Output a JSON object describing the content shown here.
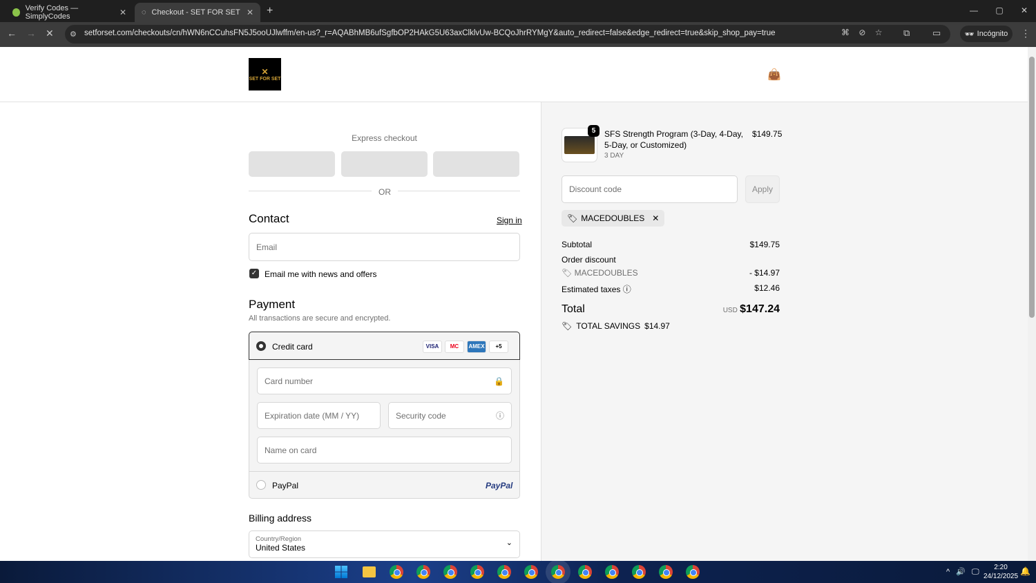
{
  "browser": {
    "tabs": [
      {
        "title": "Verify Codes — SimplyCodes"
      },
      {
        "title": "Checkout - SET FOR SET"
      }
    ],
    "url": "setforset.com/checkouts/cn/hWN6nCCuhsFN5J5ooUJlwffm/en-us?_r=AQABhMB6ufSgfbOP2HAkG5U63axClklvUw-BCQoJhrRYMgY&auto_redirect=false&edge_redirect=true&skip_shop_pay=true",
    "incognito_label": "Incógnito"
  },
  "store": {
    "logo_text": "SET FOR SET"
  },
  "checkout": {
    "express_label": "Express checkout",
    "or_label": "OR",
    "contact": {
      "heading": "Contact",
      "sign_in": "Sign in",
      "email_placeholder": "Email",
      "newsletter_label": "Email me with news and offers",
      "newsletter_checked": true
    },
    "payment": {
      "heading": "Payment",
      "subtext": "All transactions are secure and encrypted.",
      "credit_card_label": "Credit card",
      "cards": [
        "VISA",
        "MC",
        "AMEX",
        "+5"
      ],
      "card_number": "Card number",
      "expiry": "Expiration date (MM / YY)",
      "security": "Security code",
      "name_on_card": "Name on card",
      "paypal_label": "PayPal",
      "paypal_logo": "PayPal"
    },
    "billing": {
      "heading": "Billing address",
      "country_label": "Country/Region",
      "country_value": "United States"
    }
  },
  "summary": {
    "item": {
      "quantity": "5",
      "name": "SFS Strength Program (3-Day, 4-Day, 5-Day, or Customized)",
      "variant": "3 DAY",
      "price": "$149.75"
    },
    "discount_placeholder": "Discount code",
    "apply_label": "Apply",
    "applied_code": "MACEDOUBLES",
    "subtotal_label": "Subtotal",
    "subtotal": "$149.75",
    "order_discount_label": "Order discount",
    "discount_code": "MACEDOUBLES",
    "discount_amount": "- $14.97",
    "taxes_label": "Estimated taxes",
    "taxes": "$12.46",
    "total_label": "Total",
    "currency": "USD",
    "total": "$147.24",
    "savings_label": "TOTAL SAVINGS",
    "savings": "$14.97"
  },
  "taskbar": {
    "time": "2:20",
    "date": "24/12/2025"
  }
}
